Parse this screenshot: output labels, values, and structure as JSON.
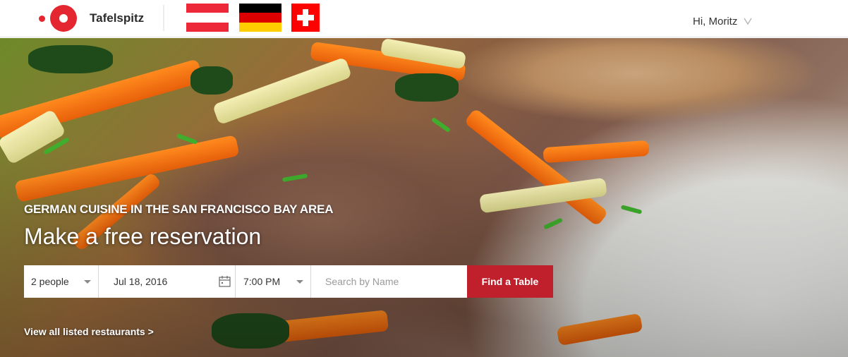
{
  "brand": {
    "name": "Tafelspitz"
  },
  "flags": [
    {
      "country": "Austria",
      "icon": "austria-flag-icon",
      "colors": [
        "#ed2939",
        "#ffffff",
        "#ed2939"
      ]
    },
    {
      "country": "Germany",
      "icon": "germany-flag-icon",
      "colors": [
        "#000000",
        "#dd0000",
        "#ffce00"
      ]
    },
    {
      "country": "Switzerland",
      "icon": "switzerland-flag-icon",
      "colors": [
        "#ff0000",
        "#ffffff"
      ]
    }
  ],
  "user": {
    "greeting": "Hi, Moritz",
    "menu_icon": "chevron-down-icon"
  },
  "hero": {
    "tagline": "GERMAN CUISINE IN THE SAN FRANCISCO BAY AREA",
    "headline": "Make a free reservation"
  },
  "search": {
    "party_size": "2 people",
    "date": "Jul 18, 2016",
    "date_icon": "calendar-icon",
    "time": "7:00 PM",
    "name_placeholder": "Search by Name",
    "submit_label": "Find a Table"
  },
  "links": {
    "view_all": "View all listed restaurants >"
  },
  "colors": {
    "brand_red": "#e3262f",
    "button_red": "#c0202b"
  }
}
